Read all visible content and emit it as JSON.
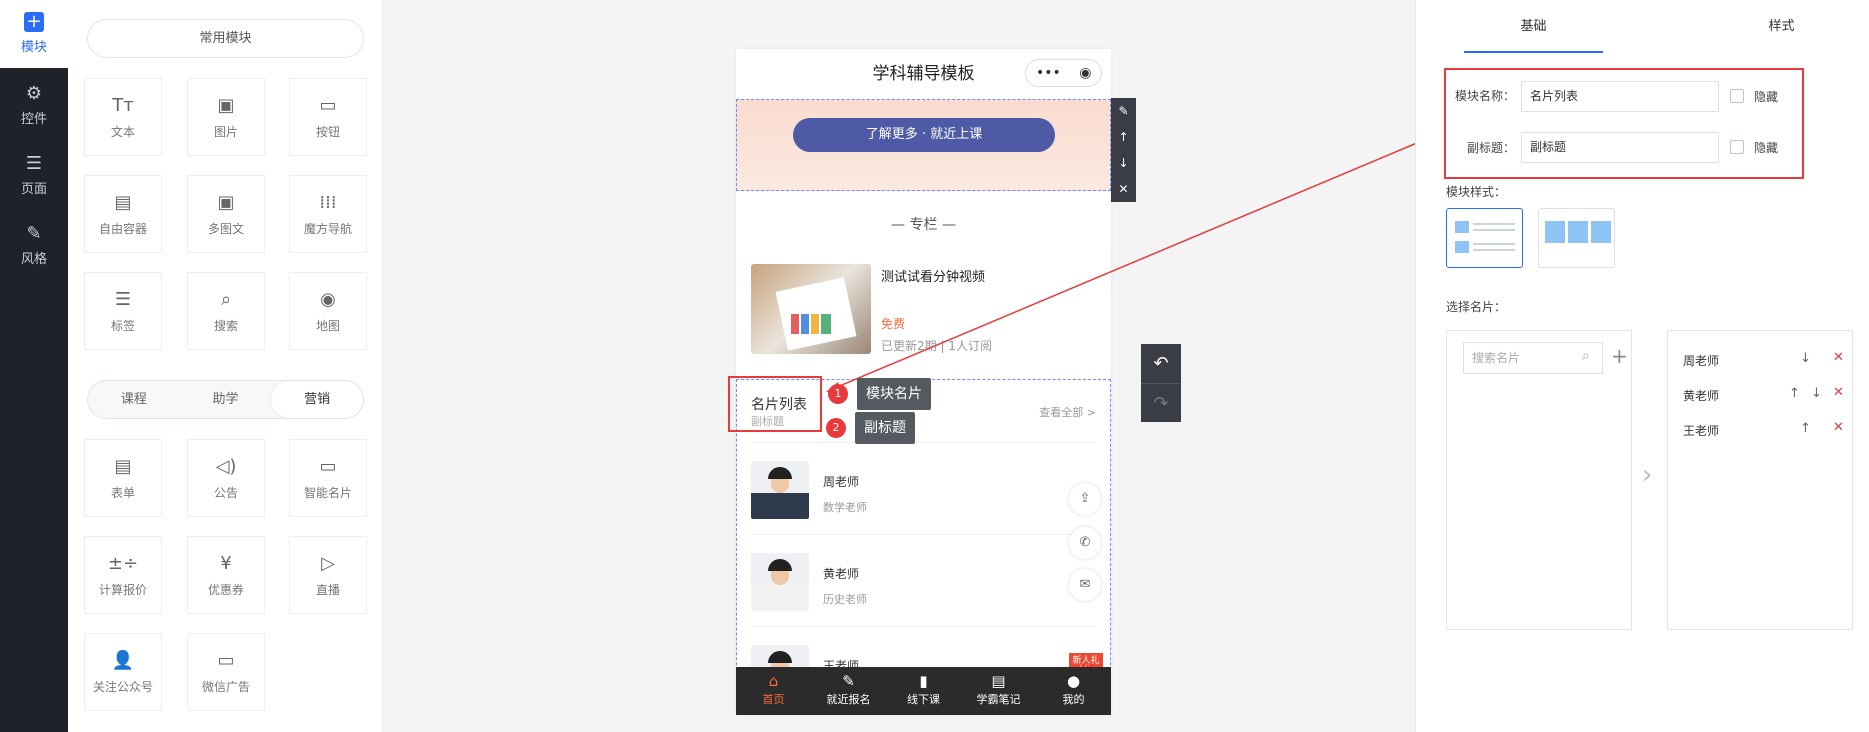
{
  "nav": {
    "items": [
      {
        "label": "模块",
        "icon": "plus-square-icon"
      },
      {
        "label": "控件",
        "icon": "sliders-icon"
      },
      {
        "label": "页面",
        "icon": "page-icon"
      },
      {
        "label": "风格",
        "icon": "magic-wand-icon"
      }
    ]
  },
  "widgets": {
    "common_label": "常用模块",
    "common": [
      "文本",
      "图片",
      "按钮",
      "自由容器",
      "多图文",
      "魔方导航",
      "标签",
      "搜索",
      "地图"
    ],
    "tabs": [
      "课程",
      "助学",
      "营销"
    ],
    "marketing": [
      "表单",
      "公告",
      "智能名片",
      "计算报价",
      "优惠券",
      "直播",
      "关注公众号",
      "微信广告"
    ]
  },
  "phone": {
    "title": "学科辅导模板",
    "capsule": "••• ◉",
    "banner_button": "了解更多 · 就近上课",
    "section_title": "专栏",
    "course": {
      "title": "测试试看分钟视频",
      "price": "免费",
      "meta": "已更新2期 | 1人订阅"
    },
    "cardlist": {
      "title": "名片列表",
      "subtitle": "副标题",
      "view_all": "查看全部 >",
      "people": [
        {
          "name": "周老师",
          "role": "数学老师"
        },
        {
          "name": "黄老师",
          "role": "历史老师"
        },
        {
          "name": "王老师",
          "role": ""
        }
      ]
    },
    "gift": "新人礼",
    "tabbar": [
      "首页",
      "就近报名",
      "线下课",
      "学霸笔记",
      "我的"
    ]
  },
  "annotations": [
    {
      "num": "1",
      "text": "模块名片"
    },
    {
      "num": "2",
      "text": "副标题"
    }
  ],
  "settings": {
    "tabs": [
      "基础",
      "样式"
    ],
    "name_label": "模块名称：",
    "name_value": "名片列表",
    "sub_label": "副标题：",
    "sub_value": "副标题",
    "hide_label": "隐藏",
    "style_label": "模块样式：",
    "select_label": "选择名片：",
    "search_placeholder": "搜索名片",
    "selected": [
      "周老师",
      "黄老师",
      "王老师"
    ]
  },
  "colors": {
    "accent": "#2b6cf6",
    "highlight": "#e8393b",
    "price": "#ff6a3d"
  }
}
